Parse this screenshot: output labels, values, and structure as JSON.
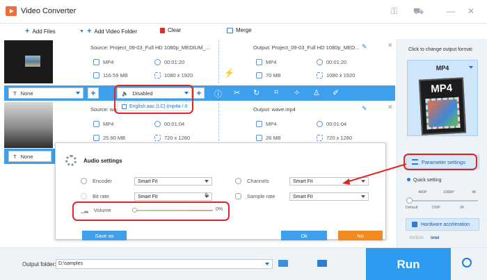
{
  "app": {
    "title": "Video Converter"
  },
  "toolbar": {
    "add_files": "Add Files",
    "add_folder": "Add Video Folder",
    "clear": "Clear",
    "merge": "Merge"
  },
  "items": [
    {
      "source": "Source: Project_09-03_Full HD 1080p_MEDIUM_...",
      "src_format": "MP4",
      "src_duration": "00:01:20",
      "src_size": "116.59 MB",
      "src_res": "1080 x 1920",
      "output": "Output: Project_09-03_Full HD 1080p_MED...",
      "out_format": "MP4",
      "out_duration": "00:01:20",
      "out_size": "70 MB",
      "out_res": "1080 x 1920",
      "subtitle": "None",
      "audio": "Disabled",
      "audio_option": "English aac (LC) (mp4a / 0"
    },
    {
      "source": "Source: wa",
      "src_format": "MP4",
      "src_duration": "00:01:04",
      "src_size": "25.90 MB",
      "src_res": "720 x 1280",
      "output": "Output: wave.mp4",
      "out_format": "MP4",
      "out_duration": "00:01:04",
      "out_size": "26 MB",
      "out_res": "720 x 1280",
      "subtitle": "None"
    }
  ],
  "right_panel": {
    "hint": "Click to change output format:",
    "format": "MP4",
    "format_art_label": "MP4",
    "param_settings": "Parameter settings",
    "quick_setting": "Quick setting",
    "ticks_top": [
      "480P",
      "1080P",
      "4K"
    ],
    "ticks_bottom": [
      "Default",
      "720P",
      "2K"
    ],
    "hw_accel": "Hardware acceleration",
    "vendor_nvidia": "NVIDIA",
    "vendor_intel": "Intel"
  },
  "audio_dialog": {
    "title": "Audio settings",
    "encoder_label": "Encoder",
    "encoder_value": "Smart Fit",
    "bitrate_label": "Bit rate",
    "bitrate_value": "Smart Fit",
    "channels_label": "Channels",
    "channels_value": "Smart Fit",
    "samplerate_label": "Sample rate",
    "samplerate_value": "Smart Fit",
    "volume_label": "Volume",
    "volume_value": "0%",
    "volume_level": 0,
    "save_as": "Save as",
    "ok": "Ok",
    "no": "No"
  },
  "bottom": {
    "output_folder_label": "Output folder:",
    "output_folder_value": "D:\\samples",
    "run": "Run"
  },
  "colors": {
    "accent": "#3ea0ec",
    "run": "#2d9cf0",
    "highlight": "#e02424",
    "no_button": "#f28a1d"
  }
}
